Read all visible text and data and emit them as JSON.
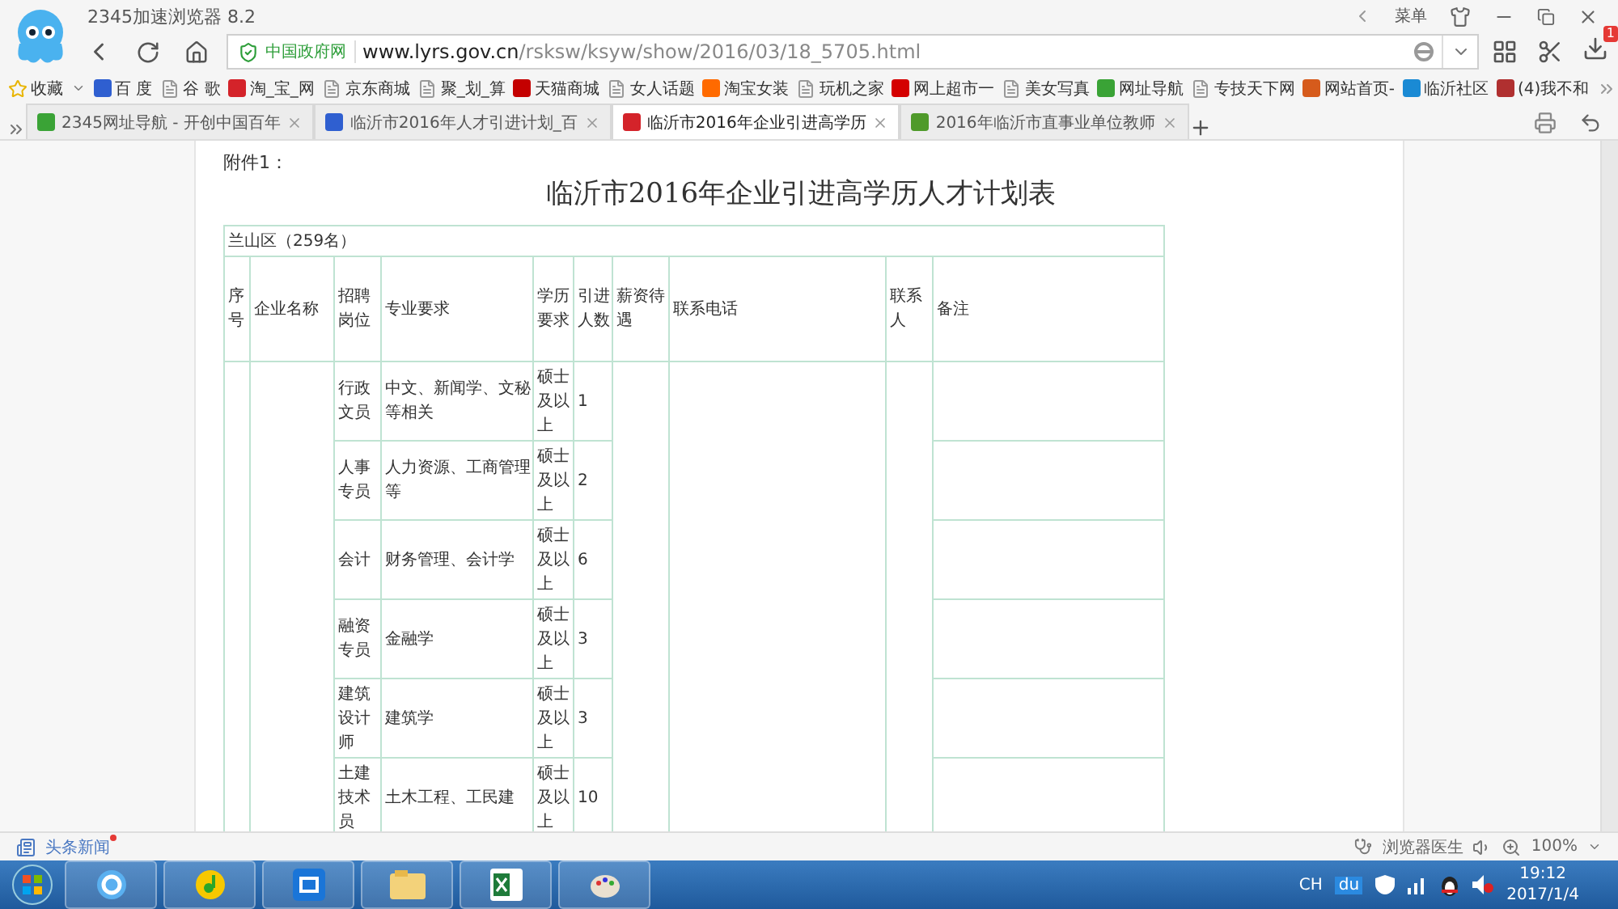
{
  "browser": {
    "title": "2345加速浏览器 8.2",
    "menu_label": "菜单",
    "site_badge": "中国政府网",
    "url_host": "www.lyrs.gov.cn",
    "url_path": "/rsksw/ksyw/show/2016/03/18_5705.html",
    "download_badge": "1"
  },
  "bookmarks": {
    "label": "收藏",
    "items": [
      {
        "label": "百 度",
        "kind": "logo"
      },
      {
        "label": "谷 歌",
        "kind": "page"
      },
      {
        "label": "淘_宝_网",
        "kind": "logo"
      },
      {
        "label": "京东商城",
        "kind": "page"
      },
      {
        "label": "聚_划_算",
        "kind": "page"
      },
      {
        "label": "天猫商城",
        "kind": "logo"
      },
      {
        "label": "女人话题",
        "kind": "page"
      },
      {
        "label": "淘宝女装",
        "kind": "logo"
      },
      {
        "label": "玩机之家",
        "kind": "page"
      },
      {
        "label": "网上超市一",
        "kind": "logo"
      },
      {
        "label": "美女写真",
        "kind": "page"
      },
      {
        "label": "网址导航",
        "kind": "logo"
      },
      {
        "label": "专技天下网",
        "kind": "page"
      },
      {
        "label": "网站首页-",
        "kind": "logo"
      },
      {
        "label": "临沂社区",
        "kind": "logo"
      },
      {
        "label": "(4)我不和",
        "kind": "logo"
      }
    ]
  },
  "tabs": [
    {
      "label": "2345网址导航 - 开创中国百年",
      "selected": false
    },
    {
      "label": "临沂市2016年人才引进计划_百",
      "selected": false
    },
    {
      "label": "临沂市2016年企业引进高学历",
      "selected": true
    },
    {
      "label": "2016年临沂市直事业单位教师",
      "selected": false
    }
  ],
  "document": {
    "attachment": "附件1：",
    "title": "临沂市2016年企业引进高学历人才计划表",
    "table": {
      "section": "兰山区（259名）",
      "columns": [
        "序号",
        "企业名称",
        "招聘岗位",
        "专业要求",
        "学历要求",
        "引进人数",
        "薪资待遇",
        "联系电话",
        "联系人",
        "备注"
      ],
      "rows": [
        {
          "position": "行政文员",
          "major": "中文、新闻学、文秘等相关",
          "degree": "硕士及以上",
          "count": "1"
        },
        {
          "position": "人事专员",
          "major": "人力资源、工商管理等",
          "degree": "硕士及以上",
          "count": "2"
        },
        {
          "position": "会计",
          "major": "财务管理、会计学",
          "degree": "硕士及以上",
          "count": "6"
        },
        {
          "position": "融资专员",
          "major": "金融学",
          "degree": "硕士及以上",
          "count": "3"
        },
        {
          "position": "建筑设计师",
          "major": "建筑学",
          "degree": "硕士及以上",
          "count": "3"
        },
        {
          "position": "土建技术员",
          "major": "土木工程、工民建",
          "degree": "硕士及以上",
          "count": "10"
        }
      ]
    }
  },
  "status_bar": {
    "news": "头条新闻",
    "doctor": "浏览器医生",
    "zoom": "100%"
  },
  "taskbar": {
    "ime": "CH",
    "tray_badge": "du",
    "time": "19:12",
    "date": "2017/1/4"
  }
}
